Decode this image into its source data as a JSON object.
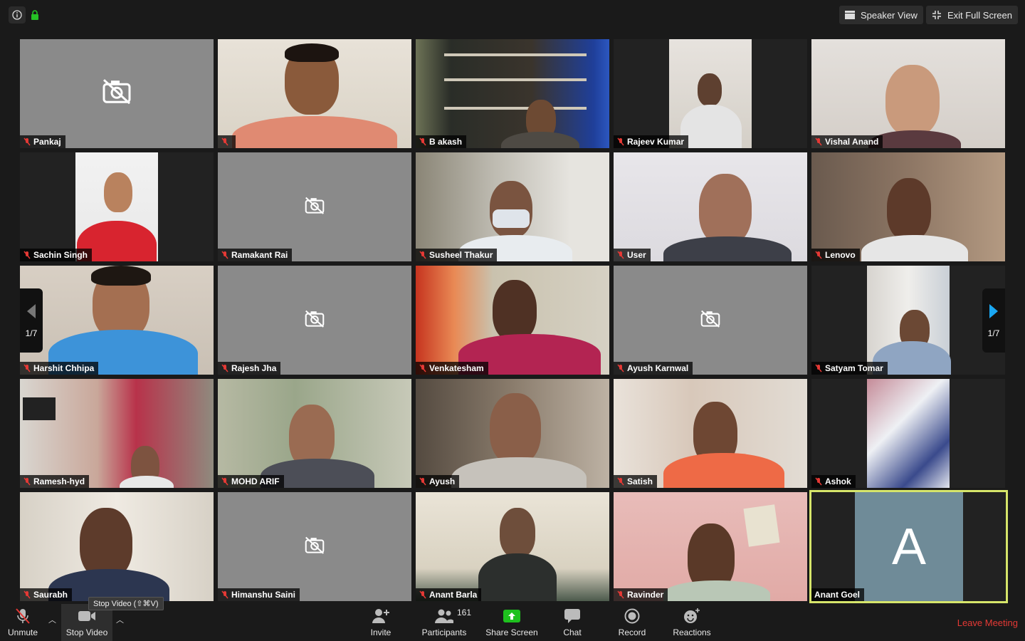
{
  "top": {
    "speaker_view": "Speaker View",
    "exit_full_screen": "Exit Full Screen"
  },
  "pager": {
    "left": "1/7",
    "right": "1/7"
  },
  "participants": [
    {
      "name": "Pankaj",
      "video": false
    },
    {
      "name": "",
      "video": true
    },
    {
      "name": "B akash",
      "video": true
    },
    {
      "name": "Rajeev Kumar",
      "video": true
    },
    {
      "name": "Vishal Anand",
      "video": true
    },
    {
      "name": "Sachin Singh",
      "video": true
    },
    {
      "name": "Ramakant Rai",
      "video": false
    },
    {
      "name": "Susheel Thakur",
      "video": true
    },
    {
      "name": "User",
      "video": true
    },
    {
      "name": "Lenovo",
      "video": true
    },
    {
      "name": "Harshit Chhipa",
      "video": true
    },
    {
      "name": "Rajesh Jha",
      "video": false
    },
    {
      "name": "Venkatesham",
      "video": true
    },
    {
      "name": "Ayush Karnwal",
      "video": false
    },
    {
      "name": "Satyam Tomar",
      "video": true
    },
    {
      "name": "Ramesh-hyd",
      "video": true
    },
    {
      "name": "MOHD ARIF",
      "video": true
    },
    {
      "name": "Ayush",
      "video": true
    },
    {
      "name": "Satish",
      "video": true
    },
    {
      "name": "Ashok",
      "video": true
    },
    {
      "name": "Saurabh",
      "video": true
    },
    {
      "name": "Himanshu Saini",
      "video": false
    },
    {
      "name": "Anant Barla",
      "video": true
    },
    {
      "name": "Ravinder",
      "video": true
    },
    {
      "name": "Anant Goel",
      "video": false,
      "avatar_letter": "A",
      "active_speaker": true
    }
  ],
  "toolbar": {
    "unmute": "Unmute",
    "stop_video": "Stop Video",
    "stop_video_tooltip": "Stop Video (⇧⌘V)",
    "invite": "Invite",
    "participants": "Participants",
    "participants_count": "161",
    "share_screen": "Share Screen",
    "chat": "Chat",
    "record": "Record",
    "reactions": "Reactions",
    "leave": "Leave Meeting"
  },
  "colors": {
    "background": "#1a1a1a",
    "active_speaker_border": "#d6e56a",
    "share_green": "#1ec11e",
    "leave_red": "#e53935",
    "muted_red": "#e53935",
    "pager_blue": "#1aa7f2"
  }
}
